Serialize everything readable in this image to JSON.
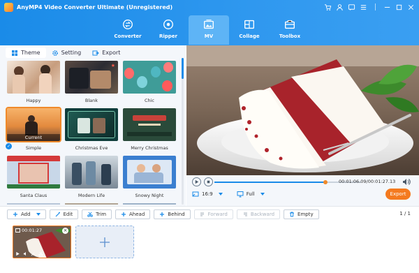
{
  "app": {
    "title": "AnyMP4 Video Converter Ultimate (Unregistered)"
  },
  "window_controls": [
    "cart-icon",
    "user-icon",
    "chat-icon",
    "menu-icon",
    "minimize-icon",
    "maximize-icon",
    "close-icon"
  ],
  "nav": {
    "tabs": [
      {
        "label": "Converter",
        "icon": "converter-icon"
      },
      {
        "label": "Ripper",
        "icon": "ripper-icon"
      },
      {
        "label": "MV",
        "icon": "mv-icon",
        "active": true
      },
      {
        "label": "Collage",
        "icon": "collage-icon"
      },
      {
        "label": "Toolbox",
        "icon": "toolbox-icon"
      }
    ]
  },
  "subtabs": [
    {
      "label": "Theme",
      "icon": "grid-icon",
      "active": true
    },
    {
      "label": "Setting",
      "icon": "gear-icon"
    },
    {
      "label": "Export",
      "icon": "export-icon"
    }
  ],
  "themes": [
    {
      "label": "Happy"
    },
    {
      "label": "Blank"
    },
    {
      "label": "Chic"
    },
    {
      "label": "Simple",
      "current_tag": "Current",
      "selected": true
    },
    {
      "label": "Christmas Eve"
    },
    {
      "label": "Merry Christmas"
    },
    {
      "label": "Santa Claus"
    },
    {
      "label": "Modern Life"
    },
    {
      "label": "Snowy Night"
    }
  ],
  "player": {
    "timecode": "00:01:06.09/00:01:27.13",
    "progress": 0.758,
    "aspect_ratio": "16:9",
    "view_mode": "Full",
    "export_label": "Export"
  },
  "toolbar": {
    "add": "Add",
    "edit": "Edit",
    "trim": "Trim",
    "ahead": "Ahead",
    "behind": "Behind",
    "forward": "Forward",
    "backward": "Backward",
    "empty": "Empty",
    "page": "1 / 1"
  },
  "clip": {
    "duration": "00:01:27"
  },
  "colors": {
    "accent": "#1a8be8",
    "highlight": "#f47a1f",
    "nav_bg": "#2f98ef"
  }
}
